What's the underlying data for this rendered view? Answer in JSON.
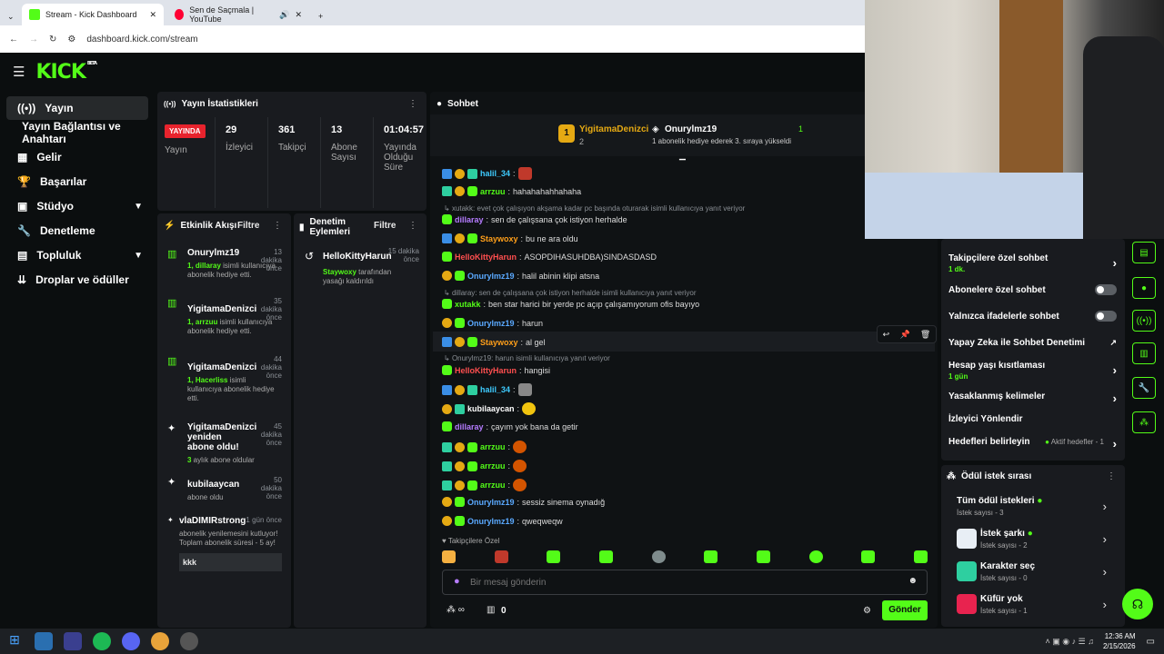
{
  "browser": {
    "tabs": [
      {
        "label": "Stream - Kick Dashboard"
      },
      {
        "label": "Sen de Saçmala | YouTube"
      }
    ],
    "url": "dashboard.kick.com/stream"
  },
  "kick": {
    "logo": "KICK",
    "beta": "BETA"
  },
  "sidebar": {
    "items": [
      {
        "label": "Yayın"
      },
      {
        "label": "Yayın Bağlantısı ve Anahtarı"
      },
      {
        "label": "Gelir"
      },
      {
        "label": "Başarılar"
      },
      {
        "label": "Stüdyo"
      },
      {
        "label": "Denetleme"
      },
      {
        "label": "Topluluk"
      },
      {
        "label": "Droplar ve ödüller"
      }
    ]
  },
  "stats": {
    "title": "Yayın İstatistikleri",
    "live_badge": "YAYINDA",
    "live_label": "Yayın",
    "viewers": {
      "value": "29",
      "label": "İzleyici"
    },
    "followers": {
      "value": "361",
      "label": "Takipçi"
    },
    "subs": {
      "value": "13",
      "label": "Abone Sayısı"
    },
    "uptime": {
      "value": "01:04:57",
      "label": "Yayında Olduğu Süre"
    }
  },
  "activity": {
    "title": "Etkinlik Akışı",
    "filter": "Filtre",
    "events": [
      {
        "name": "Onurylmz19",
        "time": "13 dakika önce",
        "pre": "1, dillaray",
        "desc": " isimli kullanıcıya abonelik hediye etti."
      },
      {
        "name": "YigitamaDenizci",
        "time": "35 dakika önce",
        "pre": "1, arrzuu",
        "desc": " isimli kullanıcıya abonelik hediye etti."
      },
      {
        "name": "YigitamaDenizci",
        "time": "44 dakika önce",
        "pre": "1, Hacerliss",
        "desc": " isimli kullanıcıya abonelik hediye etti."
      },
      {
        "name": "YigitamaDenizci yeniden abone oldu!",
        "time": "45 dakika önce",
        "pre": "3",
        "desc": " aylık abone oldular"
      },
      {
        "name": "kubilaaycan",
        "time": "50 dakika önce",
        "pre": "",
        "desc": "abone oldu"
      },
      {
        "name": "vlaDIMIRstrong",
        "time": "1 gün önce",
        "pre": "",
        "desc": "abonelik yenilemesini kutluyor! Toplam abonelik süresi - 5 ay!",
        "quote": "kkk"
      }
    ]
  },
  "moderation": {
    "title": "Denetim Eylemleri",
    "filter": "Filtre",
    "item": {
      "name": "HelloKittyHarun",
      "time": "15 dakika önce",
      "actor": "Staywoxy",
      "desc": " tarafından yasağı kaldırıldı"
    }
  },
  "chat": {
    "title": "Sohbet",
    "pinned": {
      "gifter": "YigitamaDenizci",
      "gifter_count": "2",
      "user": "Onurylmz19",
      "user_count": "1",
      "desc": "1 abonelik hediye ederek 3. sıraya yükseldi"
    },
    "messages": [
      {
        "user": "halil_34",
        "text": "",
        "color": "#3ecbff"
      },
      {
        "user": "arrzuu",
        "text": "hahahahahhahaha",
        "color": "#53fc18"
      },
      {
        "reply": "xutakk: evet çok çalışıyon akşama kadar pc başında oturarak isimli kullanıcıya yanıt veriyor"
      },
      {
        "user": "dillaray",
        "text": "sen de çalışsana çok istiyon herhalde",
        "color": "#b57cff"
      },
      {
        "user": "Staywoxy",
        "text": "bu ne ara oldu",
        "color": "#ff9f1a"
      },
      {
        "user": "HelloKittyHarun",
        "text": "ASOPDIHASUHDBA)SINDASDASD",
        "color": "#ff4f4f"
      },
      {
        "user": "Onurylmz19",
        "text": "halil abinin klipi atsna",
        "color": "#5aa9ff"
      },
      {
        "reply": "dillaray: sen de çalışsana çok istiyon herhalde isimli kullanıcıya yanıt veriyor"
      },
      {
        "user": "xutakk",
        "text": "ben star harici bir yerde pc açıp çalışamıyorum ofis bayıyo",
        "color": "#53fc18"
      },
      {
        "user": "Onurylmz19",
        "text": "harun",
        "color": "#5aa9ff"
      },
      {
        "user": "Staywoxy",
        "text": "al gel",
        "color": "#ff9f1a"
      },
      {
        "reply": "Onurylmz19: harun isimli kullanıcıya yanıt veriyor"
      },
      {
        "user": "HelloKittyHarun",
        "text": "hangisi",
        "color": "#ff4f4f"
      },
      {
        "user": "halil_34",
        "text": "",
        "color": "#3ecbff"
      },
      {
        "user": "kubilaaycan",
        "text": "",
        "color": "#53fc18"
      },
      {
        "user": "dillaray",
        "text": "çayım yok bana da getir",
        "color": "#b57cff"
      },
      {
        "user": "arrzuu",
        "text": "",
        "color": "#53fc18"
      },
      {
        "user": "arrzuu",
        "text": "",
        "color": "#53fc18"
      },
      {
        "user": "arrzuu",
        "text": "",
        "color": "#53fc18"
      },
      {
        "user": "Onurylmz19",
        "text": "sessiz sinema oynadığ",
        "color": "#5aa9ff"
      },
      {
        "user": "Onurylmz19",
        "text": "qweqweqw",
        "color": "#5aa9ff"
      }
    ],
    "follower_only": "Takipçilere Özel",
    "input_placeholder": "Bir mesaj gönderin",
    "points": "0",
    "send": "Gönder"
  },
  "chat_settings": {
    "items": [
      {
        "label": "Takipçilere özel sohbet",
        "sub": "1 dk."
      },
      {
        "label": "Abonelere özel sohbet"
      },
      {
        "label": "Yalnızca ifadelerle sohbet"
      },
      {
        "label": "Yapay Zeka ile Sohbet Denetimi"
      },
      {
        "label": "Hesap yaşı kısıtlaması",
        "sub": "1 gün"
      },
      {
        "label": "Yasaklanmış kelimeler"
      },
      {
        "label": "İzleyici Yönlendir"
      },
      {
        "label": "Hedefleri belirleyin",
        "sub": "Aktif hedefler - 1"
      }
    ]
  },
  "rewards": {
    "title": "Ödül istek sırası",
    "items": [
      {
        "label": "Tüm ödül istekleri",
        "count": "İstek sayısı - 3"
      },
      {
        "label": "İstek şarkı",
        "count": "İstek sayısı - 2"
      },
      {
        "label": "Karakter seç",
        "count": "İstek sayısı - 0"
      },
      {
        "label": "Küfür yok",
        "count": "İstek sayısı - 1"
      }
    ]
  },
  "taskbar": {
    "time": "12:36 AM",
    "date": "2/15/2026"
  }
}
